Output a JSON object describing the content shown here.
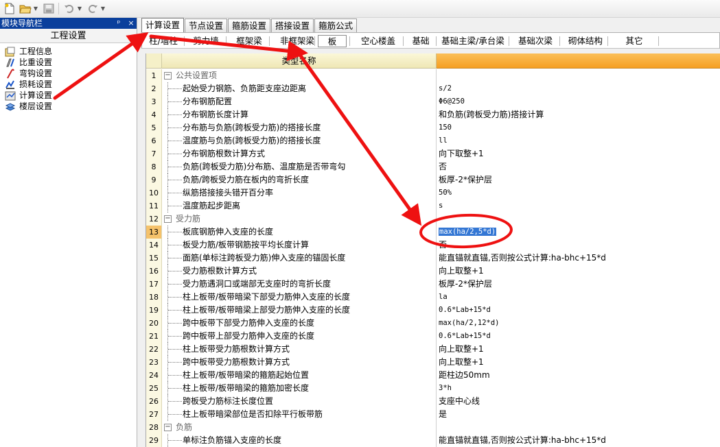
{
  "toolbar": {
    "icons": [
      "new-file-icon",
      "open-folder-icon",
      "save-icon",
      "undo-icon",
      "redo-icon"
    ]
  },
  "left_pane": {
    "title": "模块导航栏",
    "pin_glyph": "ᵖ",
    "close_glyph": "×",
    "subtitle": "工程设置",
    "items": [
      {
        "label": "工程信息",
        "icon": "project-info-icon"
      },
      {
        "label": "比重设置",
        "icon": "weight-ratio-icon"
      },
      {
        "label": "弯钩设置",
        "icon": "hook-icon"
      },
      {
        "label": "损耗设置",
        "icon": "loss-icon"
      },
      {
        "label": "计算设置",
        "icon": "calc-settings-icon"
      },
      {
        "label": "楼层设置",
        "icon": "floor-settings-icon"
      }
    ]
  },
  "tabs": [
    {
      "label": "计算设置",
      "active": true
    },
    {
      "label": "节点设置",
      "active": false
    },
    {
      "label": "箍筋设置",
      "active": false
    },
    {
      "label": "搭接设置",
      "active": false
    },
    {
      "label": "箍筋公式",
      "active": false
    }
  ],
  "subtabs": [
    {
      "label": "柱/墙柱"
    },
    {
      "label": "剪力墙"
    },
    {
      "label": "框架梁"
    },
    {
      "label": "非框架梁"
    },
    {
      "label": "板",
      "active": true
    },
    {
      "label": "空心楼盖"
    },
    {
      "label": "基础"
    },
    {
      "label": "基础主梁/承台梁"
    },
    {
      "label": "基础次梁"
    },
    {
      "label": "砌体结构"
    },
    {
      "label": "其它"
    }
  ],
  "grid": {
    "header": {
      "name": "类型名称",
      "value": ""
    },
    "rows": [
      {
        "num": "1",
        "group": true,
        "name": "公共设置项",
        "value": ""
      },
      {
        "num": "2",
        "name": "起始受力钢筋、负筋距支座边距离",
        "value": "s/2"
      },
      {
        "num": "3",
        "name": "分布钢筋配置",
        "value": "Φ6@250"
      },
      {
        "num": "4",
        "name": "分布钢筋长度计算",
        "value": "和负筋(跨板受力筋)搭接计算"
      },
      {
        "num": "5",
        "name": "分布筋与负筋(跨板受力筋)的搭接长度",
        "value": "150"
      },
      {
        "num": "6",
        "name": "温度筋与负筋(跨板受力筋)的搭接长度",
        "value": "ll"
      },
      {
        "num": "7",
        "name": "分布钢筋根数计算方式",
        "value": "向下取整+1"
      },
      {
        "num": "8",
        "name": "负筋(跨板受力筋)分布筋、温度筋是否带弯勾",
        "value": "否"
      },
      {
        "num": "9",
        "name": "负筋/跨板受力筋在板内的弯折长度",
        "value": "板厚-2*保护层"
      },
      {
        "num": "10",
        "name": "纵筋搭接接头错开百分率",
        "value": "50%"
      },
      {
        "num": "11",
        "name": "温度筋起步距离",
        "value": "s"
      },
      {
        "num": "12",
        "group": true,
        "name": "受力筋",
        "value": ""
      },
      {
        "num": "13",
        "name": "板底钢筋伸入支座的长度",
        "value": "max(ha/2,5*d)",
        "selected": true
      },
      {
        "num": "14",
        "name": "板受力筋/板带钢筋按平均长度计算",
        "value": "否"
      },
      {
        "num": "15",
        "name": "面筋(单标注跨板受力筋)伸入支座的锚固长度",
        "value": "能直锚就直锚,否则按公式计算:ha-bhc+15*d"
      },
      {
        "num": "16",
        "name": "受力筋根数计算方式",
        "value": "向上取整+1"
      },
      {
        "num": "17",
        "name": "受力筋遇洞口或端部无支座时的弯折长度",
        "value": "板厚-2*保护层"
      },
      {
        "num": "18",
        "name": "柱上板带/板带暗梁下部受力筋伸入支座的长度",
        "value": "la"
      },
      {
        "num": "19",
        "name": "柱上板带/板带暗梁上部受力筋伸入支座的长度",
        "value": "0.6*Lab+15*d"
      },
      {
        "num": "20",
        "name": "跨中板带下部受力筋伸入支座的长度",
        "value": "max(ha/2,12*d)"
      },
      {
        "num": "21",
        "name": "跨中板带上部受力筋伸入支座的长度",
        "value": "0.6*Lab+15*d"
      },
      {
        "num": "22",
        "name": "柱上板带受力筋根数计算方式",
        "value": "向上取整+1"
      },
      {
        "num": "23",
        "name": "跨中板带受力筋根数计算方式",
        "value": "向上取整+1"
      },
      {
        "num": "24",
        "name": "柱上板带/板带暗梁的箍筋起始位置",
        "value": "距柱边50mm"
      },
      {
        "num": "25",
        "name": "柱上板带/板带暗梁的箍筋加密长度",
        "value": "3*h"
      },
      {
        "num": "26",
        "name": "跨板受力筋标注长度位置",
        "value": "支座中心线"
      },
      {
        "num": "27",
        "name": "柱上板带暗梁部位是否扣除平行板带筋",
        "value": "是"
      },
      {
        "num": "28",
        "group": true,
        "name": "负筋",
        "value": ""
      },
      {
        "num": "29",
        "name": "单标注负筋锚入支座的长度",
        "value": "能直锚就直锚,否则按公式计算:ha-bhc+15*d"
      }
    ]
  },
  "colors": {
    "pane_title_bg": "#0a3f9c",
    "header_value_bg": "#f59f22",
    "annotation": "#ee1111",
    "selection": "#3477d4"
  }
}
